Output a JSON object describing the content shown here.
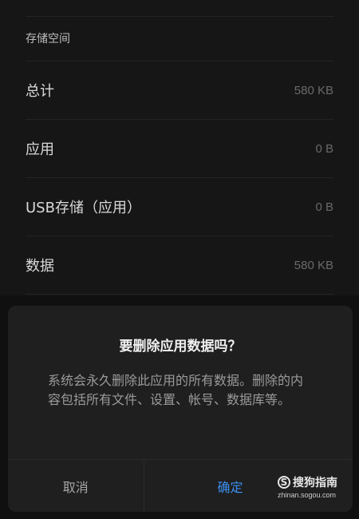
{
  "storage": {
    "section_title": "存储空间",
    "rows": [
      {
        "label": "总计",
        "value": "580 KB"
      },
      {
        "label": "应用",
        "value": "0 B"
      },
      {
        "label": "USB存储（应用）",
        "value": "0 B"
      },
      {
        "label": "数据",
        "value": "580 KB"
      }
    ]
  },
  "dialog": {
    "title": "要删除应用数据吗？",
    "message": "系统会永久删除此应用的所有数据。删除的内容包括所有文件、设置、帐号、数据库等。",
    "cancel_label": "取消",
    "confirm_label": "确定"
  },
  "watermark": {
    "logo_letter": "S",
    "brand": "搜狗指南",
    "url": "zhinan.sogou.com"
  },
  "colors": {
    "background": "#161616",
    "dialog": "#1f1f1f",
    "accent": "#3d8ff0"
  }
}
